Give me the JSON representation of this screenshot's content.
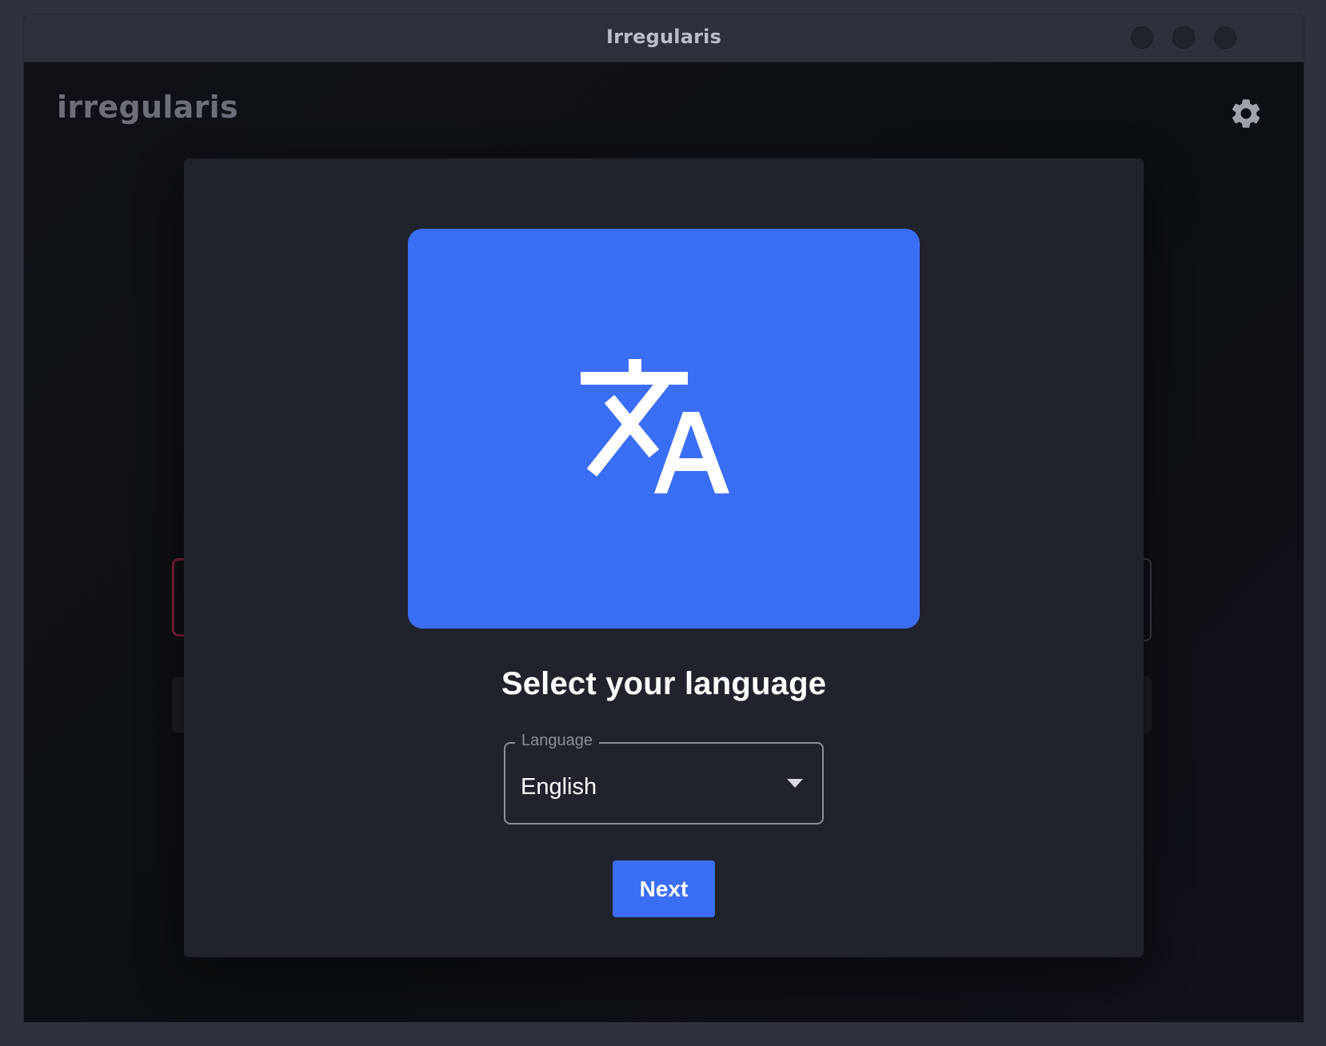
{
  "window": {
    "title": "Irregularis"
  },
  "app": {
    "brand": "irregularis",
    "settings_icon": "gear-icon"
  },
  "dialog": {
    "hero_icon": "translate-icon",
    "title": "Select your language",
    "language_select": {
      "label": "Language",
      "value": "English"
    },
    "next_label": "Next"
  },
  "colors": {
    "accent": "#3a6ef5",
    "dialog_bg": "#20232c",
    "titlebar_bg": "#2d313c"
  }
}
